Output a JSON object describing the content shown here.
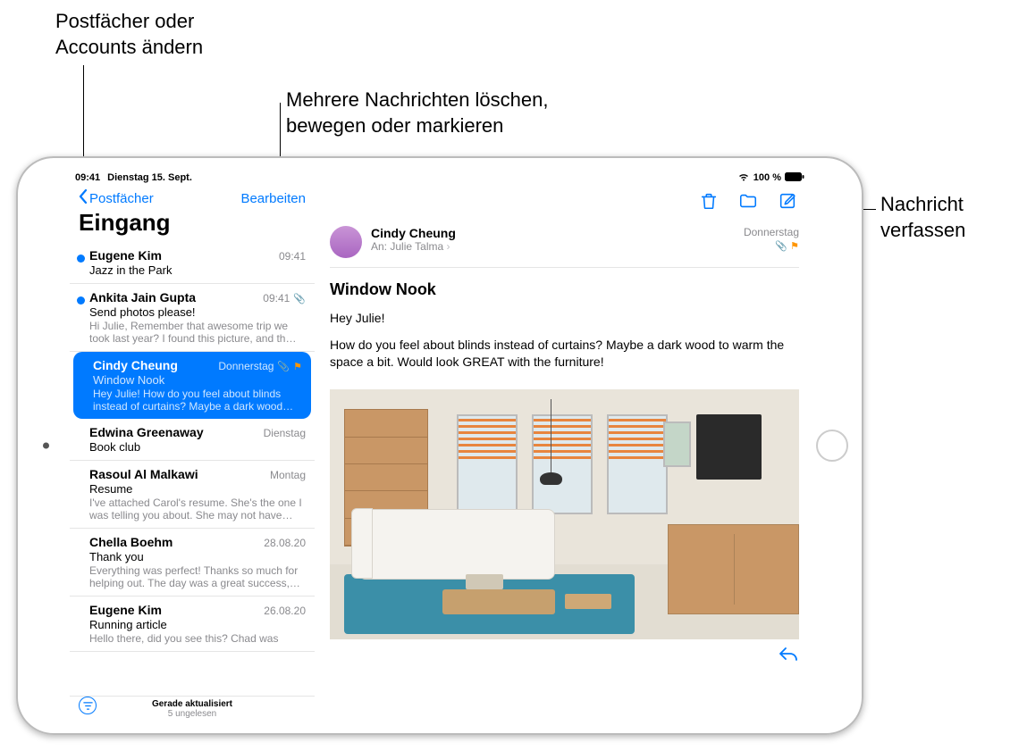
{
  "callouts": {
    "mailboxes": "Postfächer oder\nAccounts ändern",
    "edit_multi": "Mehrere Nachrichten löschen,\nbewegen oder markieren",
    "compose": "Nachricht\nverfassen"
  },
  "status_bar": {
    "time": "09:41",
    "date": "Dienstag 15. Sept.",
    "battery": "100 %"
  },
  "sidebar": {
    "back_label": "Postfächer",
    "edit_label": "Bearbeiten",
    "title": "Eingang",
    "footer_status": "Gerade aktualisiert",
    "footer_unread": "5 ungelesen"
  },
  "messages": [
    {
      "sender": "Eugene Kim",
      "time": "09:41",
      "subject": "Jazz in the Park",
      "preview": "",
      "unread": true,
      "selected": false,
      "attachment": false,
      "flag": false
    },
    {
      "sender": "Ankita Jain Gupta",
      "time": "09:41",
      "subject": "Send photos please!",
      "preview": "Hi Julie, Remember that awesome trip we took last year? I found this picture, and th…",
      "unread": true,
      "selected": false,
      "attachment": true,
      "flag": false
    },
    {
      "sender": "Cindy Cheung",
      "time": "Donnerstag",
      "subject": "Window Nook",
      "preview": "Hey Julie! How do you feel about blinds instead of curtains? Maybe a dark wood to…",
      "unread": false,
      "selected": true,
      "attachment": true,
      "flag": true
    },
    {
      "sender": "Edwina Greenaway",
      "time": "Dienstag",
      "subject": "Book club",
      "preview": "",
      "unread": false,
      "selected": false,
      "attachment": false,
      "flag": false
    },
    {
      "sender": "Rasoul Al Malkawi",
      "time": "Montag",
      "subject": "Resume",
      "preview": "I've attached Carol's resume. She's the one I was telling you about. She may not have…",
      "unread": false,
      "selected": false,
      "attachment": false,
      "flag": false
    },
    {
      "sender": "Chella Boehm",
      "time": "28.08.20",
      "subject": "Thank you",
      "preview": "Everything was perfect! Thanks so much for helping out. The day was a great success,…",
      "unread": false,
      "selected": false,
      "attachment": false,
      "flag": false
    },
    {
      "sender": "Eugene Kim",
      "time": "26.08.20",
      "subject": "Running article",
      "preview": "Hello there, did you see this? Chad was",
      "unread": false,
      "selected": false,
      "attachment": false,
      "flag": false
    }
  ],
  "mail": {
    "from": "Cindy Cheung",
    "to_label": "An:",
    "to_name": "Julie Talma",
    "date": "Donnerstag",
    "subject": "Window Nook",
    "greeting": "Hey Julie!",
    "body": "How do you feel about blinds instead of curtains? Maybe a dark wood to warm the space a bit. Would look GREAT with the furniture!"
  },
  "colors": {
    "accent": "#007aff",
    "flag": "#ff9500"
  }
}
